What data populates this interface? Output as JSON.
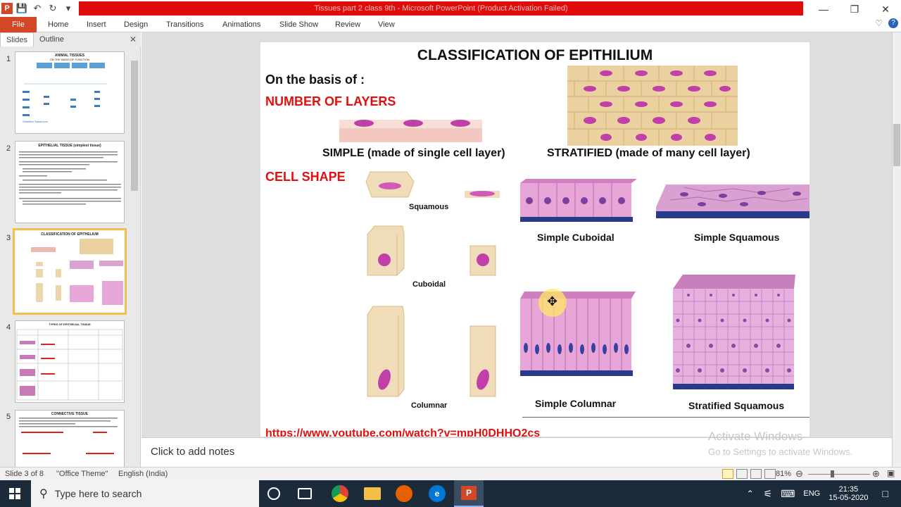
{
  "window": {
    "title": "Tissues part 2 class 9th  -  Microsoft PowerPoint (Product Activation Failed)",
    "app_icon": "P"
  },
  "qat": {
    "icons": [
      "save-icon",
      "undo-icon",
      "redo-icon",
      "customize-icon"
    ]
  },
  "ribbon": {
    "file": "File",
    "tabs": [
      "Home",
      "Insert",
      "Design",
      "Transitions",
      "Animations",
      "Slide Show",
      "Review",
      "View"
    ]
  },
  "left_panel": {
    "tab_slides": "Slides",
    "tab_outline": "Outline",
    "slide_numbers": [
      "1",
      "2",
      "3",
      "4",
      "5"
    ]
  },
  "thumbs": {
    "t1": {
      "title": "ANIMAL TISSUES",
      "sub": "ON THE BASIS OF FUNCTION",
      "last": "Stratified Squamous"
    },
    "t2": {
      "title": "EPITHELIAL TISSUE (simplest tissue)"
    },
    "t3": {
      "title": "CLASSIFICATION OF EPITHELIUM"
    },
    "t4": {
      "title": "TYPES OF EPITHELIAL TISSUE"
    },
    "t5": {
      "title": "CONNECTIVE TISSUE"
    }
  },
  "slide": {
    "title": "CLASSIFICATION OF EPITHILIUM",
    "basis": "On the basis of :",
    "layers_heading": "NUMBER OF LAYERS",
    "simple_label": "SIMPLE (made of single cell layer)",
    "stratified_label": "STRATIFIED (made of many cell layer)",
    "shape_heading": "CELL SHAPE",
    "squamous": "Squamous",
    "cuboidal": "Cuboidal",
    "columnar": "Columnar",
    "simple_cuboidal": "Simple Cuboidal",
    "simple_squamous": "Simple Squamous",
    "simple_columnar": "Simple Columnar",
    "stratified_squamous": "Stratified Squamous",
    "link": "https://www.youtube.com/watch?v=mpH0DHHQ2cs"
  },
  "notes": {
    "placeholder": "Click to add notes"
  },
  "watermark": {
    "line1": "Activate Windows",
    "line2": "Go to Settings to activate Windows."
  },
  "status": {
    "slide": "Slide 3 of 8",
    "theme": "\"Office Theme\"",
    "language": "English (India)",
    "zoom": "81%"
  },
  "taskbar": {
    "search": "Type here to search",
    "lang": "ENG",
    "time": "21:35",
    "date": "15-05-2020"
  },
  "colors": {
    "accent_red": "#e00b0b",
    "file_tab": "#d24726",
    "heading_red": "#e01010",
    "tissue_pink": "#e8a6d8",
    "tissue_tan": "#ecd7ad",
    "nucleus": "#c03fa8",
    "base_navy": "#2a3a8a"
  }
}
